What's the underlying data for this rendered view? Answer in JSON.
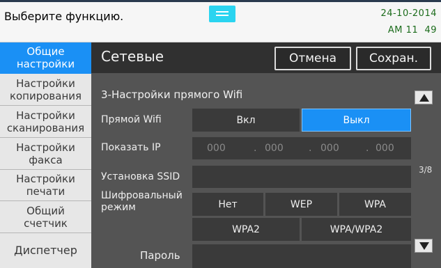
{
  "status": {
    "message": "Выберите функцию.",
    "date": "24-10-2014",
    "time": "AM 11  49",
    "menu_handle_icon": "hamburger-icon",
    "accent_color": "#2ad4f0",
    "clock_color": "#1c6c1c"
  },
  "sidebar": {
    "items": [
      {
        "line1": "Общие",
        "line2": "настройки",
        "active": true
      },
      {
        "line1": "Настройки",
        "line2": "копирования",
        "active": false
      },
      {
        "line1": "Настройки",
        "line2": "сканирования",
        "active": false
      },
      {
        "line1": "Настройки",
        "line2": "факса",
        "active": false
      },
      {
        "line1": "Настройки",
        "line2": "печати",
        "active": false
      },
      {
        "line1": "Общий",
        "line2": "счетчик",
        "active": false
      },
      {
        "line1": "Диспетчер",
        "line2": "",
        "active": false
      }
    ],
    "active_color": "#1a90f5"
  },
  "header": {
    "title": "Сетевые",
    "cancel_label": "Отмена",
    "save_label": "Сохран."
  },
  "section": {
    "title": "3-Настройки прямого Wifi",
    "page_counter": "3/8",
    "scroll_up_icon": "triangle-up-icon",
    "scroll_down_icon": "triangle-down-icon"
  },
  "direct_wifi": {
    "label": "Прямой Wifi",
    "options": [
      "Вкл",
      "Выкл"
    ],
    "selected": "Выкл"
  },
  "show_ip": {
    "label": "Показать IP",
    "octets": [
      "000",
      "000",
      "000",
      "000"
    ],
    "separator": "."
  },
  "ssid": {
    "label": "Установка SSID",
    "value": ""
  },
  "encryption": {
    "label_line1": "Шифровальный",
    "label_line2": "режим",
    "options_row1": [
      "Нет",
      "WEP",
      "WPA"
    ],
    "options_row2": [
      "WPA2",
      "WPA/WPA2"
    ]
  },
  "password": {
    "label": "Пароль",
    "value": ""
  }
}
